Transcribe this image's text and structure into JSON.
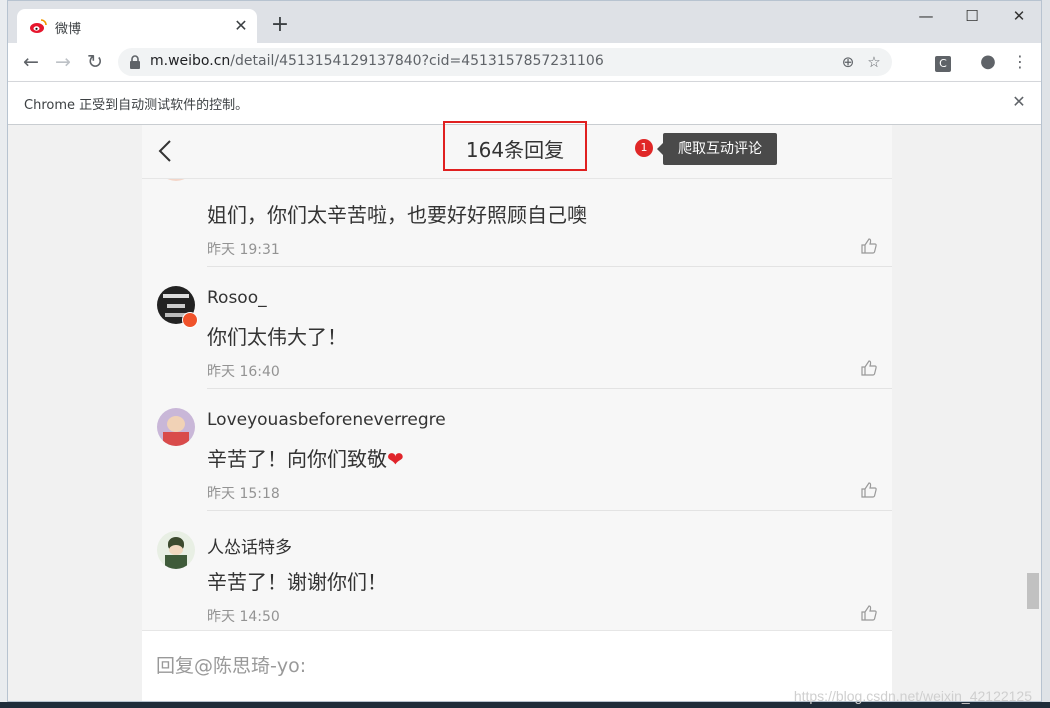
{
  "browser": {
    "tab_title": "微博",
    "url_host": "m.weibo.cn",
    "url_path": "/detail/4513154129137840?cid=4513157857231106",
    "infobar_text": "Chrome 正受到自动测试软件的控制。"
  },
  "page": {
    "title": "164条回复",
    "badge_number": "1",
    "tooltip": "爬取互动评论",
    "reply_placeholder": "回复@陈思琦-yo:"
  },
  "comments": [
    {
      "username": "",
      "text": "姐们，你们太辛苦啦，也要好好照顾自己噢",
      "time": "昨天 19:31"
    },
    {
      "username": "Rosoo_",
      "text": "你们太伟大了！",
      "time": "昨天 16:40"
    },
    {
      "username": "Loveyouasbeforeneverregre",
      "text": "辛苦了！向你们致敬",
      "emoji": "❤",
      "time": "昨天 15:18"
    },
    {
      "username": "人怂话特多",
      "text": "辛苦了！谢谢你们！",
      "time": "昨天 14:50"
    }
  ],
  "watermark": "https://blog.csdn.net/weixin_42122125",
  "colors": {
    "highlight_box": "#e02020",
    "badge": "#e02727",
    "tooltip_bg": "#4a4a4a"
  }
}
